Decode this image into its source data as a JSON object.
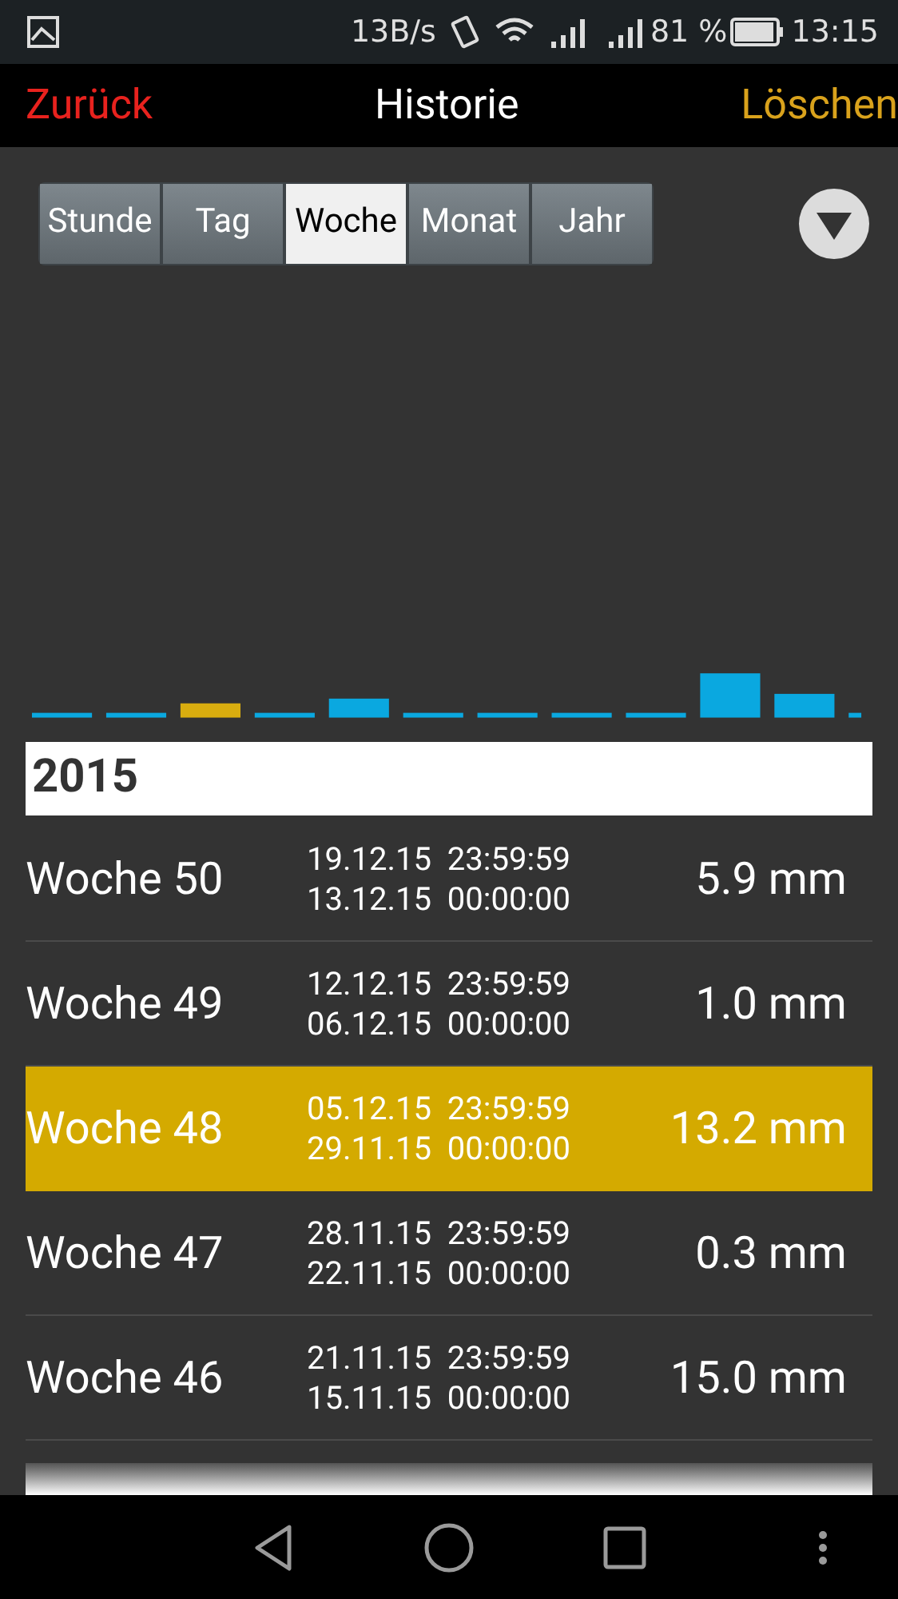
{
  "status_bar": {
    "speed": "13B/s",
    "battery": "81 %",
    "time": "13:15"
  },
  "header": {
    "back": "Zurück",
    "title": "Historie",
    "delete": "Löschen"
  },
  "tabs": [
    {
      "label": "Stunde",
      "selected": false
    },
    {
      "label": "Tag",
      "selected": false
    },
    {
      "label": "Woche",
      "selected": true
    },
    {
      "label": "Monat",
      "selected": false
    },
    {
      "label": "Jahr",
      "selected": false
    }
  ],
  "year": "2015",
  "rows": [
    {
      "week": "Woche 50",
      "end": "19.12.15  23:59:59",
      "start": "13.12.15  00:00:00",
      "amount": "5.9 mm",
      "selected": false
    },
    {
      "week": "Woche 49",
      "end": "12.12.15  23:59:59",
      "start": "06.12.15  00:00:00",
      "amount": "1.0 mm",
      "selected": false
    },
    {
      "week": "Woche 48",
      "end": "05.12.15  23:59:59",
      "start": "29.11.15  00:00:00",
      "amount": "13.2 mm",
      "selected": true
    },
    {
      "week": "Woche 47",
      "end": "28.11.15  23:59:59",
      "start": "22.11.15  00:00:00",
      "amount": "0.3 mm",
      "selected": false
    },
    {
      "week": "Woche 46",
      "end": "21.11.15  23:59:59",
      "start": "15.11.15  00:00:00",
      "amount": "15.0 mm",
      "selected": false
    }
  ]
}
